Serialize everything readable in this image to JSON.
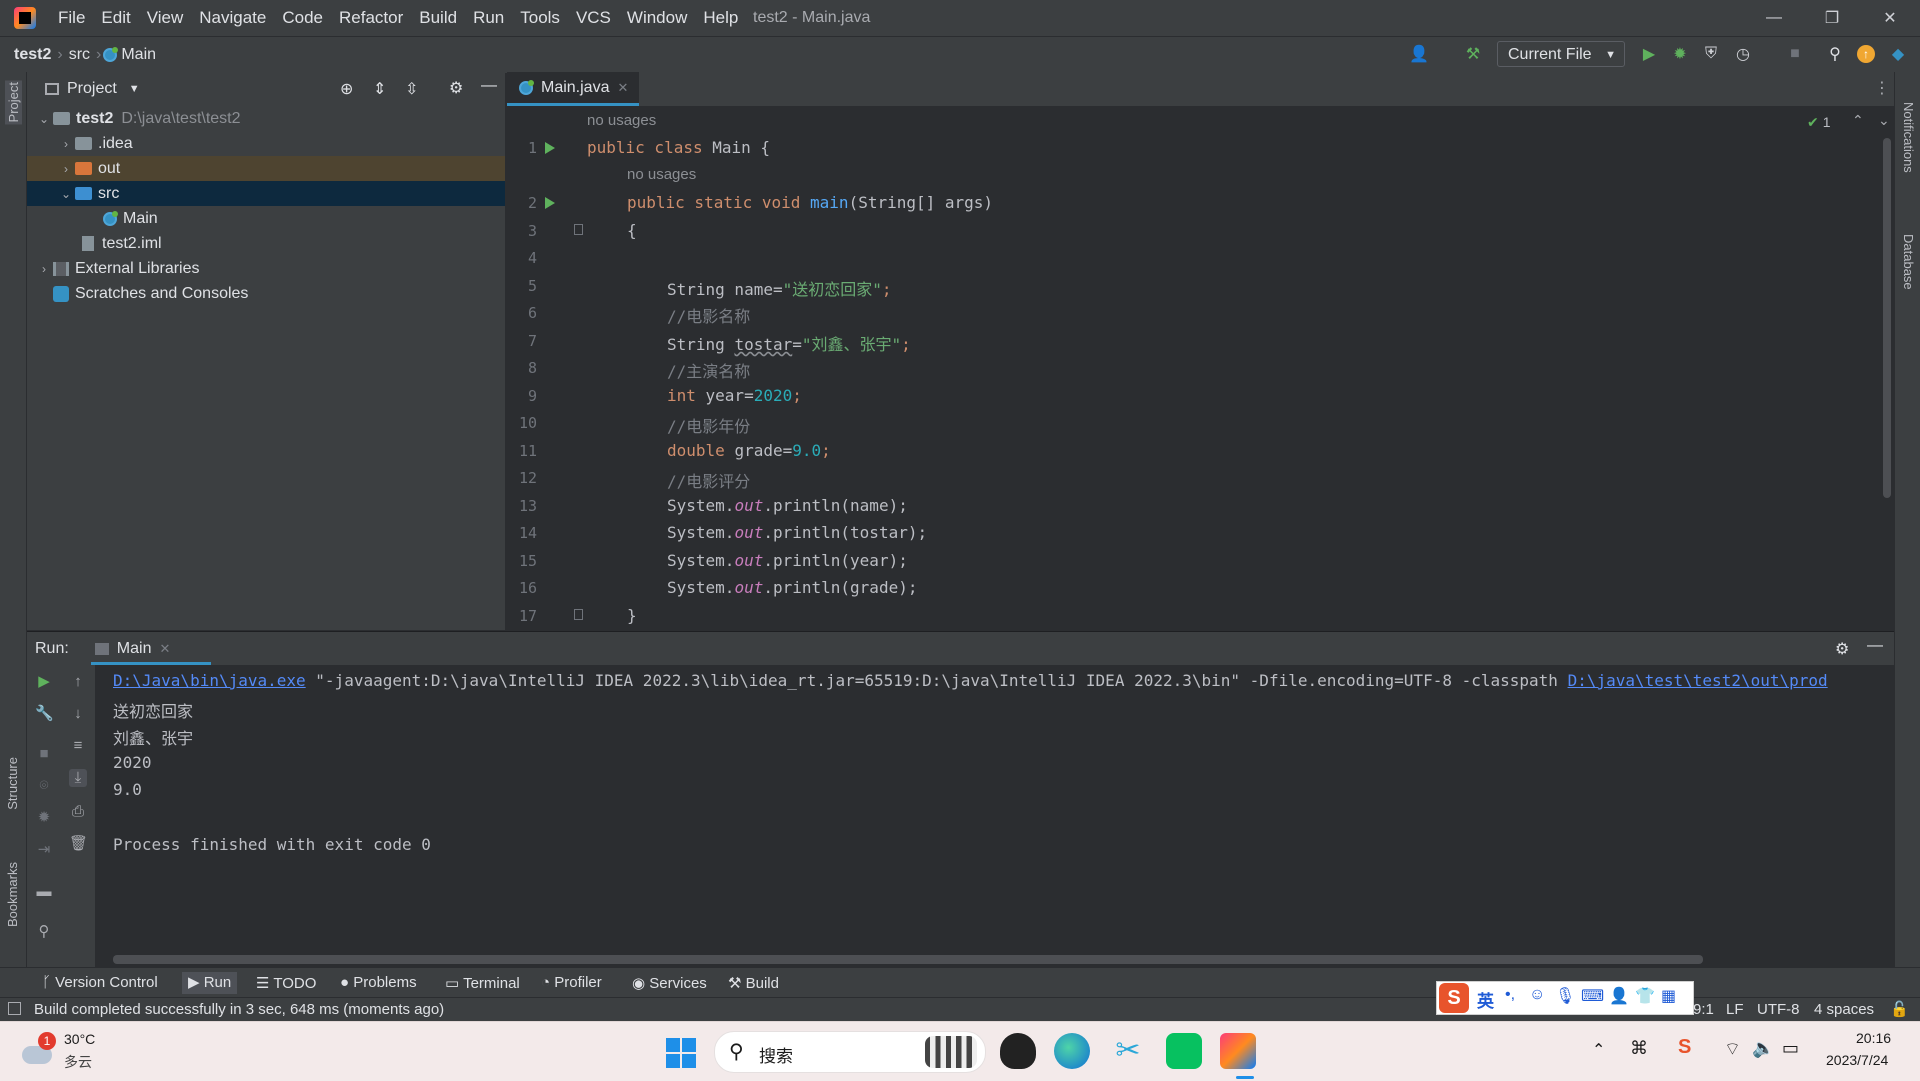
{
  "window": {
    "title": "test2 - Main.java",
    "menu": [
      "File",
      "Edit",
      "View",
      "Navigate",
      "Code",
      "Refactor",
      "Build",
      "Run",
      "Tools",
      "VCS",
      "Window",
      "Help"
    ],
    "minimize": "—",
    "maximize": "❐",
    "close": "✕"
  },
  "breadcrumb": {
    "project": "test2",
    "folder": "src",
    "file": "Main"
  },
  "toolbar": {
    "run_config": "Current File"
  },
  "project_panel": {
    "title": "Project",
    "tree": {
      "root": "test2",
      "root_path": "D:\\java\\test\\test2",
      "idea": ".idea",
      "out": "out",
      "src": "src",
      "main": "Main",
      "iml": "test2.iml",
      "libs": "External Libraries",
      "scratches": "Scratches and Consoles"
    }
  },
  "editor": {
    "tab": "Main.java",
    "inspection_count": "1",
    "hint_no_usages": "no usages",
    "line_numbers": [
      "1",
      "2",
      "3",
      "4",
      "5",
      "6",
      "7",
      "8",
      "9",
      "10",
      "11",
      "12",
      "13",
      "14",
      "15",
      "16",
      "17"
    ],
    "code": {
      "l1_kw": "public class ",
      "l1_name": "Main {",
      "l2_kw": "public static void ",
      "l2_fn": "main",
      "l2_rest": "(String[] args)",
      "l3": "{",
      "l5_a": "String name=",
      "l5_s": "\"送初恋回家\"",
      "l5_e": ";",
      "l6": "//电影名称",
      "l7_a": "String ",
      "l7_v": "tostar",
      "l7_b": "=",
      "l7_s": "\"刘鑫、张宇\"",
      "l7_e": ";",
      "l8": "//主演名称",
      "l9_kw": "int ",
      "l9_a": "year=",
      "l9_n": "2020",
      "l9_e": ";",
      "l10": "//电影年份",
      "l11_kw": "double ",
      "l11_a": "grade=",
      "l11_n": "9.0",
      "l11_e": ";",
      "l12": "//电影评分",
      "sys": "System.",
      "out": "out",
      "pl13": ".println(name);",
      "pl14": ".println(tostar);",
      "pl15": ".println(year);",
      "pl16": ".println(grade);",
      "l17": "}"
    }
  },
  "run": {
    "label": "Run:",
    "tab": "Main",
    "cmd_link": "D:\\Java\\bin\\java.exe",
    "cmd_args": " \"-javaagent:D:\\java\\IntelliJ IDEA 2022.3\\lib\\idea_rt.jar=65519:D:\\java\\IntelliJ IDEA 2022.3\\bin\" -Dfile.encoding=UTF-8 -classpath ",
    "cmd_link2": "D:\\java\\test\\test2\\out\\prod",
    "output": [
      "送初恋回家",
      "刘鑫、张宇",
      "2020",
      "9.0"
    ],
    "exit": "Process finished with exit code 0"
  },
  "bottom_tools": [
    "Version Control",
    "Run",
    "TODO",
    "Problems",
    "Terminal",
    "Profiler",
    "Services",
    "Build"
  ],
  "status": {
    "message": "Build completed successfully in 3 sec, 648 ms (moments ago)",
    "position": "9:1",
    "line_sep": "LF",
    "encoding": "UTF-8",
    "indent": "4 spaces"
  },
  "side_labels": {
    "project": "Project",
    "structure": "Structure",
    "bookmarks": "Bookmarks",
    "notifications": "Notifications",
    "database": "Database"
  },
  "ime": {
    "mode": "英"
  },
  "taskbar": {
    "weather_temp": "30°C",
    "weather_desc": "多云",
    "weather_badge": "1",
    "search": "搜索",
    "time": "20:16",
    "date": "2023/7/24"
  },
  "colors": {
    "accent": "#3592c4",
    "keyword": "#cf8e6d",
    "string": "#6aab73",
    "number": "#2aacb8",
    "link": "#548af7"
  }
}
